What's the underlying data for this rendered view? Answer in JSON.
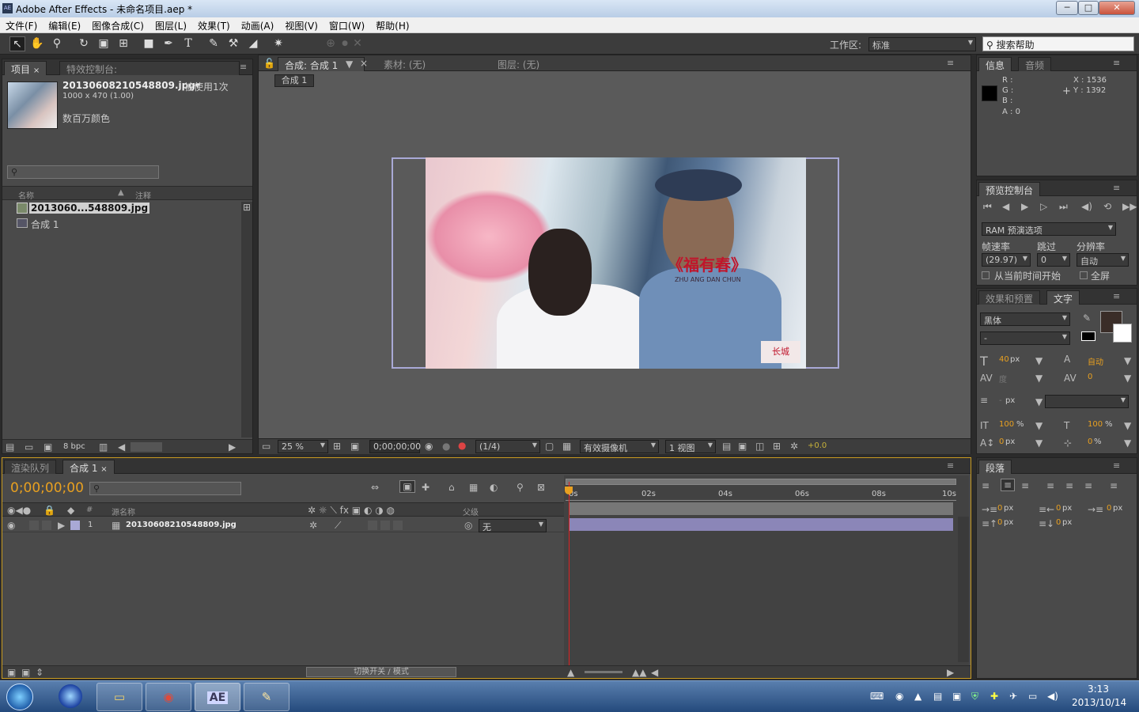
{
  "window": {
    "title": "Adobe After Effects - 未命名项目.aep *",
    "logo": "AE",
    "controls": [
      "─",
      "□",
      "✕"
    ]
  },
  "menu": [
    "文件(F)",
    "编辑(E)",
    "图像合成(C)",
    "图层(L)",
    "效果(T)",
    "动画(A)",
    "视图(V)",
    "窗口(W)",
    "帮助(H)"
  ],
  "toolbar": {
    "workspace_label": "工作区:",
    "workspace_value": "标准",
    "search_help": "搜索帮助"
  },
  "project_panel": {
    "tab_project": "项目",
    "tab_effects": "特效控制台: 20130608210548809.jpg",
    "asset_name": "20130608210548809.jpg▾",
    "used_count": "被使用1次",
    "asset_dims": "1000 x 470 (1.00)",
    "asset_colors": "数百万颜色",
    "search_placeholder": "",
    "col_name": "名称",
    "col_comment": "注释",
    "items": [
      {
        "name": "2013060...548809.jpg"
      },
      {
        "name": "合成 1"
      }
    ],
    "bpc": "8 bpc"
  },
  "comp_panel": {
    "tab_comp": "合成: 合成 1",
    "tab_footage": "素材: (无)",
    "tab_layer": "图层: (无)",
    "comp_chip": "合成 1",
    "photo_text_1": "《福有春》",
    "photo_text_2": "ZHU ANG DAN CHUN",
    "photo_stamp": "长城",
    "zoom": "25 %",
    "timecode": "0;00;00;00",
    "resolution": "(1/4)",
    "camera": "有效摄像机",
    "views": "1 视图",
    "exposure": "+0.0"
  },
  "info_panel": {
    "tab_info": "信息",
    "tab_audio": "音频",
    "r": "R :",
    "g": "G :",
    "b": "B :",
    "a": "A : 0",
    "x": "X : 1536",
    "y": "Y : 1392"
  },
  "preview_panel": {
    "tab": "预览控制台",
    "ram": "RAM 预演选项",
    "fps_label": "帧速率",
    "skip_label": "跳过",
    "res_label": "分辨率",
    "fps_value": "(29.97)",
    "skip_value": "0",
    "res_value": "自动",
    "from_current": "从当前时间开始",
    "fullscreen": "全屏"
  },
  "text_panel": {
    "tab_effects": "效果和预置",
    "tab_text": "文字",
    "font": "黑体",
    "style": "-",
    "size": "40",
    "size_unit": "px",
    "leading": "自动",
    "kerning_label": "度",
    "tracking": "0",
    "stroke": "-",
    "stroke_unit": "px",
    "vscale": "100",
    "hscale": "100",
    "pct": "%",
    "baseline": "0",
    "baseline_unit": "px",
    "tsume": "0",
    "tsume_unit": "%"
  },
  "para_panel": {
    "tab": "段落",
    "indents": [
      "0",
      "0",
      "0",
      "0",
      "0"
    ],
    "unit": "px"
  },
  "timeline": {
    "tab_render": "渲染队列",
    "tab_comp": "合成 1",
    "timecode": "0;00;00;00",
    "col_source": "源名称",
    "col_parent": "父级",
    "col_hash": "#",
    "layer_num": "1",
    "layer_name": "20130608210548809.jpg",
    "parent_value": "无",
    "toggle_modes": "切换开关 / 模式",
    "ruler": [
      "0s",
      "02s",
      "04s",
      "06s",
      "08s",
      "10s"
    ]
  },
  "taskbar": {
    "time": "3:13",
    "date": "2013/10/14",
    "ae_label": "AE"
  }
}
